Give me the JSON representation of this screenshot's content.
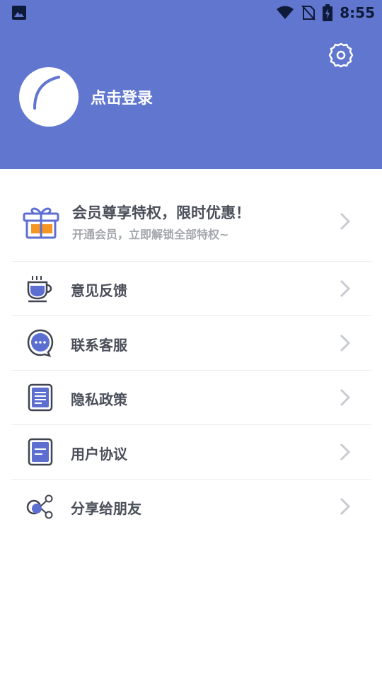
{
  "status_bar": {
    "time": "8:55",
    "icons": [
      "image-icon",
      "wifi-icon",
      "no-sim-icon",
      "battery-charging-icon"
    ]
  },
  "header": {
    "login_label": "点击登录",
    "icons": [
      "settings-icon",
      "avatar-icon"
    ]
  },
  "promo": {
    "title": "会员尊享特权，限时优惠！",
    "subtitle": "开通会员，立即解锁全部特权~",
    "icon": "gift-icon"
  },
  "menu": {
    "items": [
      {
        "label": "意见反馈",
        "icon": "coffee-cup-icon"
      },
      {
        "label": "联系客服",
        "icon": "chat-bubble-icon"
      },
      {
        "label": "隐私政策",
        "icon": "document-icon"
      },
      {
        "label": "用户协议",
        "icon": "agreement-icon"
      },
      {
        "label": "分享给朋友",
        "icon": "share-icon"
      }
    ]
  },
  "colors": {
    "header": "#6176cf",
    "accent_icon": "#5c6fd1",
    "gift_orange": "#f59524",
    "text": "#4a4f5a",
    "subtext": "#a3a6ad"
  }
}
